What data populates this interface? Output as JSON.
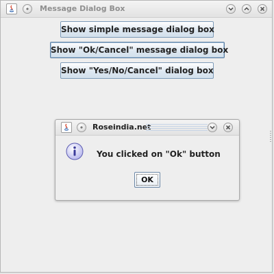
{
  "window": {
    "title": "Message Dialog Box"
  },
  "buttons": {
    "simple": "Show simple message dialog box",
    "ok_cancel": "Show \"Ok/Cancel\" message dialog box",
    "yes_no_cancel": "Show \"Yes/No/Cancel\" dialog box"
  },
  "dialog": {
    "title": "Roseindia.net",
    "message": "You clicked on \"Ok\" button",
    "ok_label": "OK",
    "icon": "info-icon"
  },
  "colors": {
    "button_border": "#7c9ab8",
    "info_icon_fill": "#b9b9ee",
    "info_icon_stroke": "#5c5cb0"
  }
}
